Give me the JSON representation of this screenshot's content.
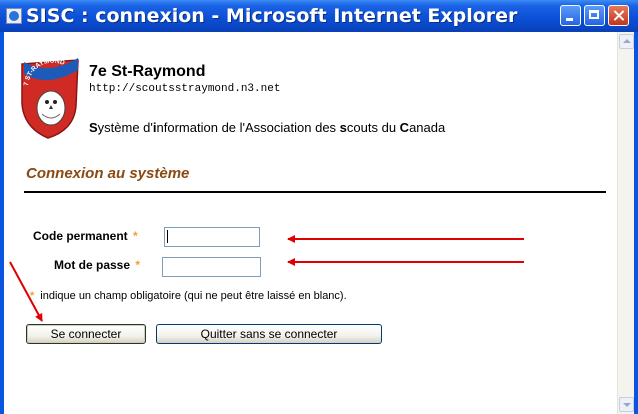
{
  "window": {
    "title": "SISC : connexion - Microsoft Internet Explorer"
  },
  "header": {
    "org_name": "7e St-Raymond",
    "org_url": "http://scoutsstraymond.n3.net",
    "logo_text": "7 ST-RAYMOND",
    "system_description": {
      "s1": "S",
      "t1": "ystème d'",
      "s2": "i",
      "t2": "nformation de l'Association des ",
      "s3": "s",
      "t3": "couts du ",
      "s4": "C",
      "t4": "anada"
    }
  },
  "form": {
    "section_title": "Connexion au système",
    "code_label": "Code permanent",
    "code_value": "",
    "password_label": "Mot de passe",
    "password_value": "",
    "required_marker": "*",
    "required_hint": "indique un champ obligatoire (qui ne peut être laissé en blanc).",
    "login_button": "Se connecter",
    "quit_button": "Quitter sans se connecter"
  },
  "colors": {
    "title_bar": "#0a50d6",
    "section_title": "#8b4a12",
    "required_star": "#f0a030",
    "annotation_arrow": "#e00000"
  }
}
